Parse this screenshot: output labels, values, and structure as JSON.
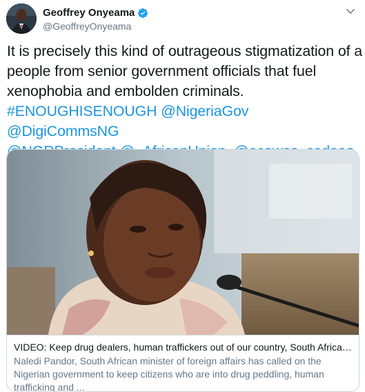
{
  "user": {
    "display_name": "Geoffrey Onyeama",
    "handle": "@GeoffreyOnyeama",
    "verified": true
  },
  "tweet": {
    "text_lines": [
      "It is precisely this kind of outrageous stigmatization of a",
      "people from senior government officials that fuel",
      "xenophobia and embolden criminals."
    ],
    "hashtag": "#ENOUGHISENOUGH",
    "mentions": [
      "@NigeriaGov",
      "@DigiCommsNG",
      "@NGRPresident",
      "@_AfricanUnion",
      "@ecowas_cedeao"
    ]
  },
  "card": {
    "title": "VIDEO: Keep drug dealers, human traffickers out of our country, South African mi...",
    "description": "Naledi Pandor, South African minister of foreign affairs has called on the Nigerian government to keep citizens who are into drug peddling, human trafficking and ..."
  },
  "icons": {
    "verified": "verified-badge-icon",
    "menu": "chevron-down-icon"
  },
  "colors": {
    "link": "#1b95e0",
    "verified": "#1da1f2",
    "muted": "#657786"
  }
}
